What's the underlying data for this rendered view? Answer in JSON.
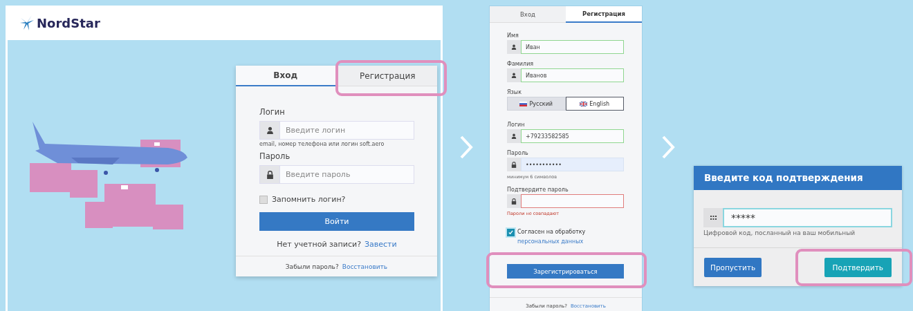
{
  "logo": {
    "text": "NordStar"
  },
  "login_panel": {
    "tabs": [
      {
        "label": "Вход",
        "selected": true,
        "highlighted": false
      },
      {
        "label": "Регистрация",
        "selected": false,
        "highlighted": true
      }
    ],
    "fields": [
      {
        "label": "Логин",
        "kind": "text",
        "placeholder": "Введите логин",
        "hint": "email, номер телефона или логин soft.aero"
      },
      {
        "label": "Пароль",
        "kind": "password",
        "placeholder": "Введите пароль"
      }
    ],
    "remember": {
      "label": "Запомнить логин?",
      "checked": false
    },
    "submit": {
      "label": "Войти"
    },
    "signup_prompt": {
      "text": "Нет учетной записи?",
      "link": "Завести"
    },
    "footer": {
      "text": "Забыли пароль?",
      "link": "Восстановить"
    }
  },
  "register_panel": {
    "tabs": [
      {
        "label": "Вход",
        "selected": false
      },
      {
        "label": "Регистрация",
        "selected": true
      }
    ],
    "name_fields": [
      {
        "label": "Имя",
        "kind": "text",
        "value": "Иван",
        "valid": true
      },
      {
        "label": "Фамилия",
        "kind": "text",
        "value": "Иванов",
        "valid": true
      }
    ],
    "language": {
      "label": "Язык",
      "options": [
        {
          "label": "Русский",
          "selected": true
        },
        {
          "label": "English",
          "selected": false
        }
      ]
    },
    "account_fields": [
      {
        "label": "Логин",
        "kind": "text",
        "value": "+79233582585",
        "valid": true,
        "invalid": false,
        "focused": false
      },
      {
        "label": "Пароль",
        "kind": "password",
        "value": "•••••••••••",
        "valid": false,
        "invalid": false,
        "focused": true,
        "hint": "минимум 6 символов"
      },
      {
        "label": "Подтвердите пароль",
        "kind": "password",
        "valid": false,
        "invalid": true,
        "focused": false,
        "error": "Пароли не совпадают"
      }
    ],
    "consent": {
      "text": "Согласен на обработку",
      "link": "персональных данных",
      "checked": true
    },
    "submit": {
      "label": "Зарегистрироваться",
      "highlighted": true
    },
    "footer": {
      "text": "Забыли пароль?",
      "link": "Восстановить"
    }
  },
  "code_dialog": {
    "title": "Введите код подтверждения",
    "field": {
      "kind": "code",
      "value": "*****",
      "focused": true
    },
    "hint": "Цифровой код, посланный на ваш мобильный",
    "buttons": [
      {
        "label": "Пропустить",
        "kind": "primary",
        "highlighted": false
      },
      {
        "label": "Подтвердить",
        "kind": "confirm",
        "highlighted": true
      }
    ]
  }
}
